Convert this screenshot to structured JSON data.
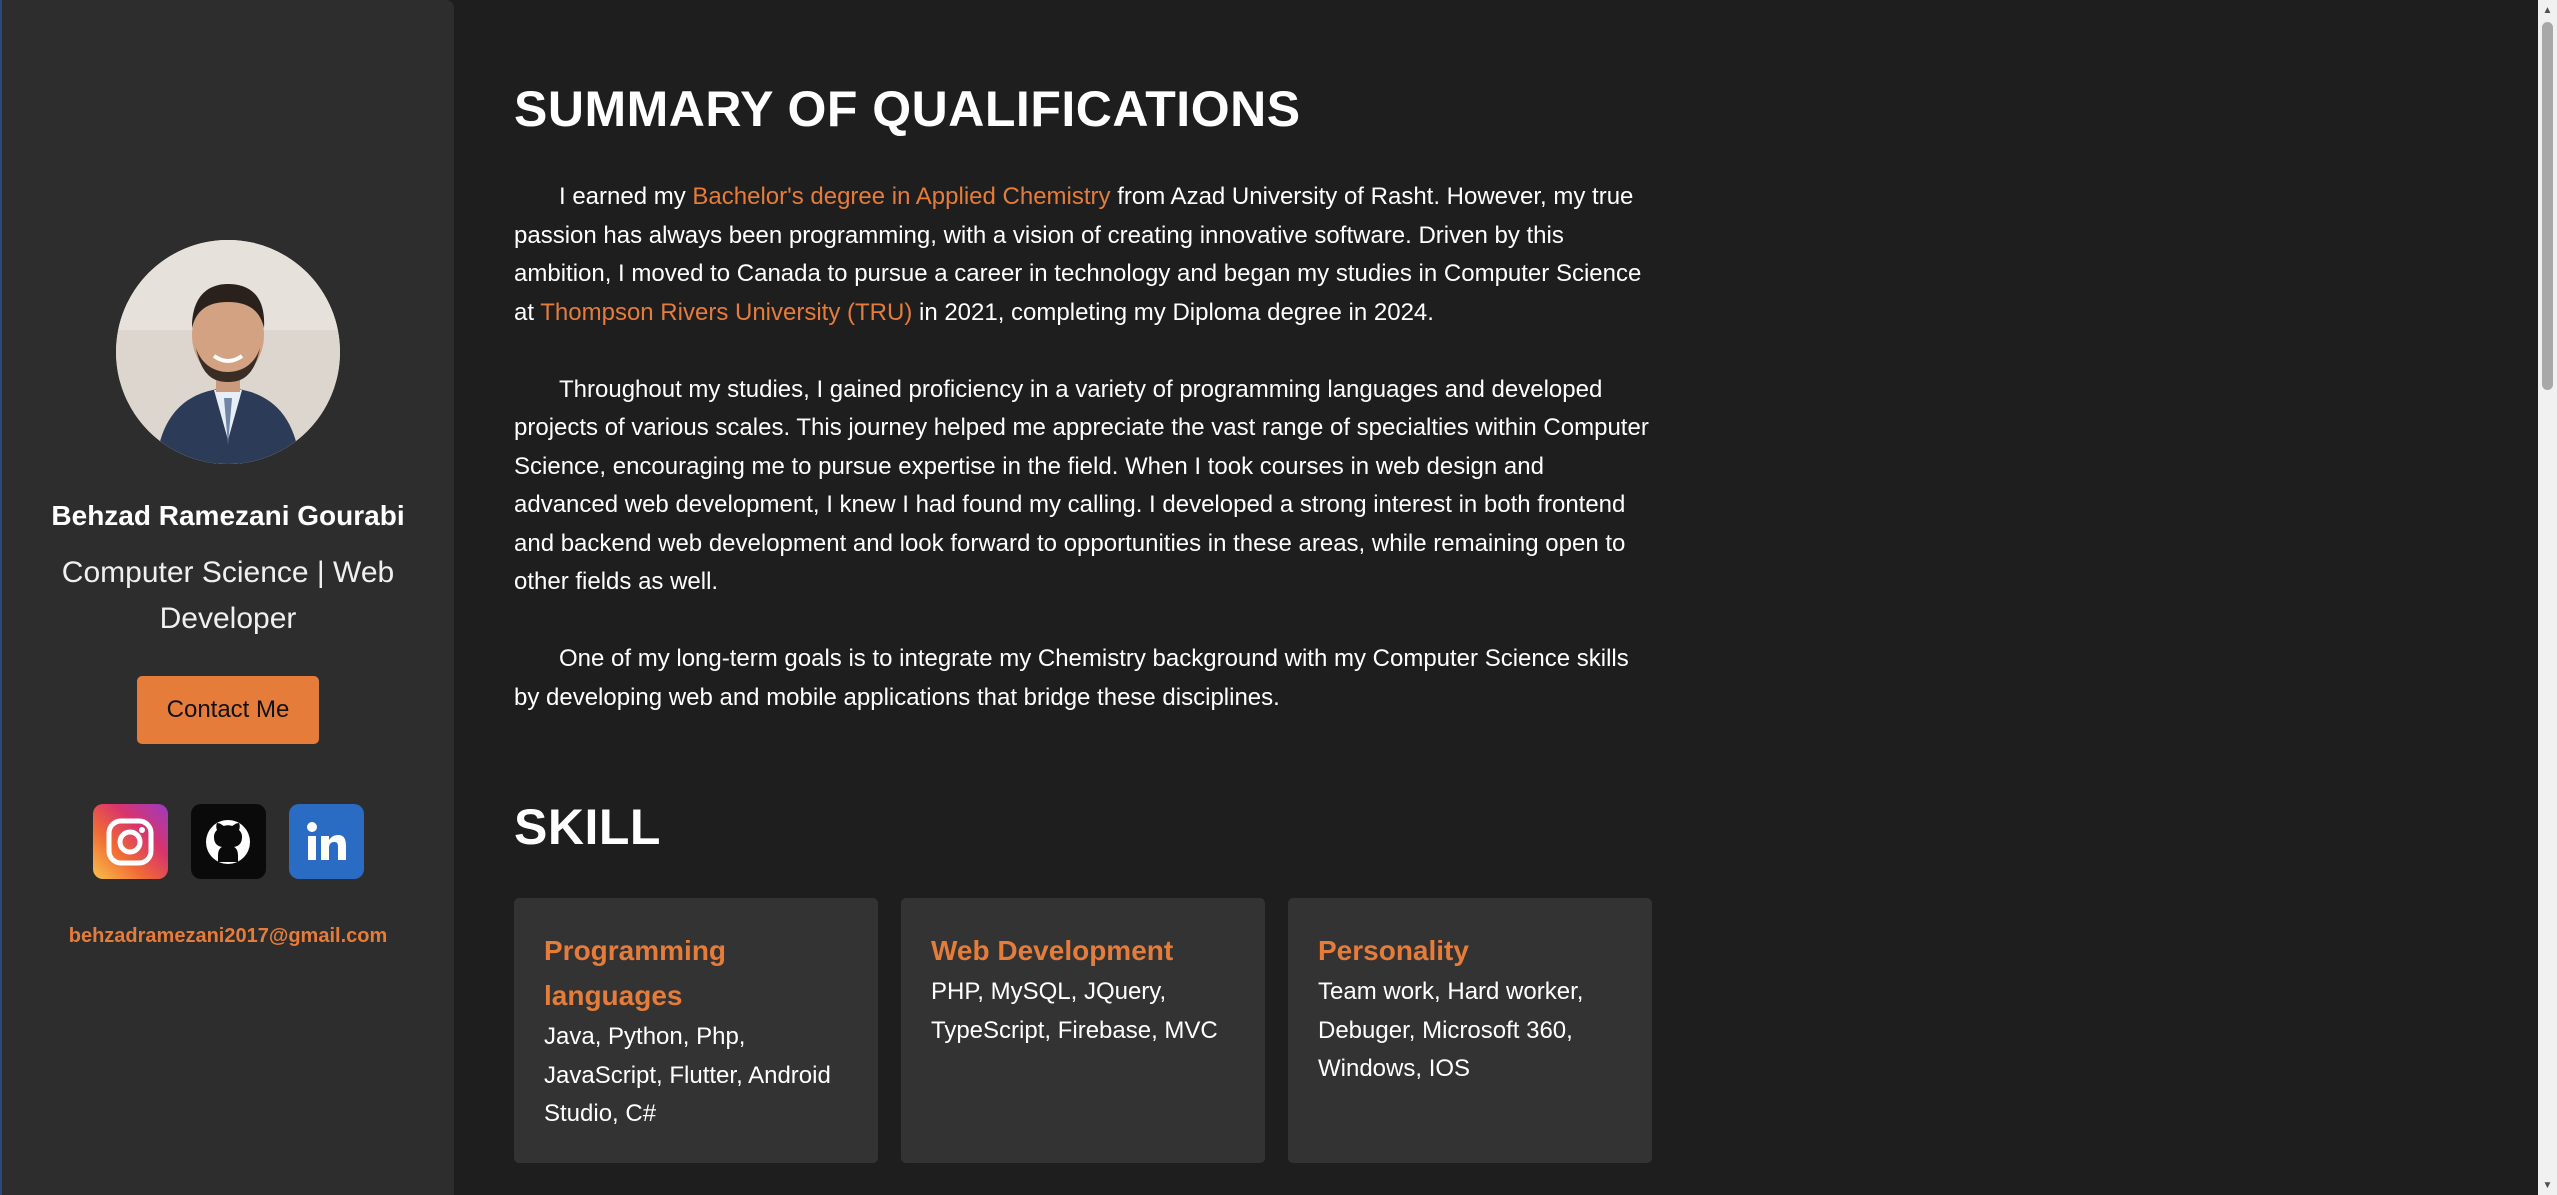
{
  "sidebar": {
    "name": "Behzad Ramezani Gourabi",
    "role": "Computer Science | Web Developer",
    "contact_button": "Contact Me",
    "socials": [
      {
        "icon": "instagram-icon"
      },
      {
        "icon": "github-icon"
      },
      {
        "icon": "linkedin-icon"
      }
    ],
    "email": "behzadramezani2017@gmail.com"
  },
  "summary": {
    "title": "SUMMARY OF QUALIFICATIONS",
    "p1": {
      "before": "I earned my ",
      "link1": "Bachelor's degree in Applied Chemistry",
      "middle": " from Azad University of Rasht. However, my true passion has always been programming, with a vision of creating innovative software. Driven by this ambition, I moved to Canada to pursue a career in technology and began my studies in Computer Science at ",
      "link2": "Thompson Rivers University (TRU)",
      "after": " in 2021, completing my Diploma degree in 2024."
    },
    "p2": "Throughout my studies, I gained proficiency in a variety of programming languages and developed projects of various scales. This journey helped me appreciate the vast range of specialties within Computer Science, encouraging me to pursue expertise in the field. When I took courses in web design and advanced web development, I knew I had found my calling. I developed a strong interest in both frontend and backend web development and look forward to opportunities in these areas, while remaining open to other fields as well.",
    "p3": "One of my long-term goals is to integrate my Chemistry background with my Computer Science skills by developing web and mobile applications that bridge these disciplines."
  },
  "skills": {
    "title": "SKILL",
    "cards": [
      {
        "title": "Programming languages",
        "text": "Java, Python, Php, JavaScript, Flutter, Android Studio, C#"
      },
      {
        "title": "Web Development",
        "text": "PHP, MySQL, JQuery, TypeScript, Firebase, MVC"
      },
      {
        "title": "Personality",
        "text": "Team work, Hard worker, Debuger, Microsoft 360, Windows, IOS"
      }
    ]
  },
  "colors": {
    "accent": "#e57c3a",
    "background": "#1e1e1e",
    "sidebar": "#2d2d2d",
    "card": "#333333"
  }
}
